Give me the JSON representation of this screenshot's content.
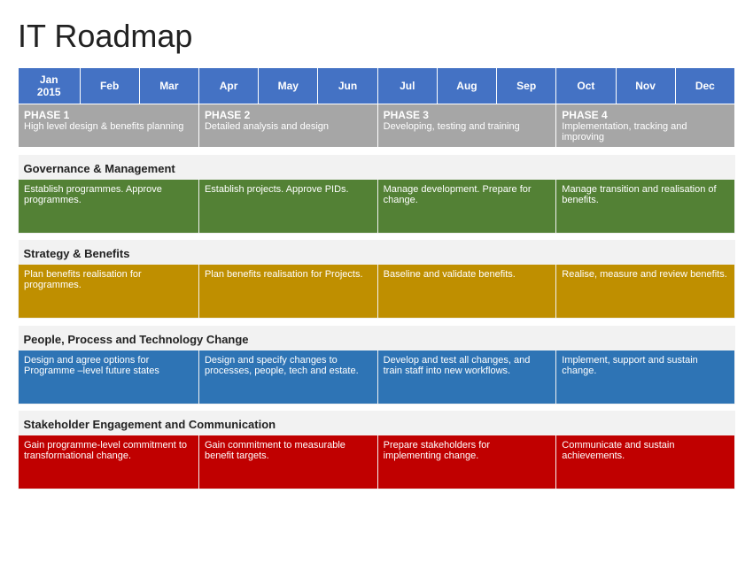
{
  "title": "IT Roadmap",
  "headers": [
    "Jan\n2015",
    "Feb",
    "Mar",
    "Apr",
    "May",
    "Jun",
    "Jul",
    "Aug",
    "Sep",
    "Oct",
    "Nov",
    "Dec"
  ],
  "phases": [
    {
      "title": "PHASE 1",
      "subtitle": "High level design & benefits planning",
      "span": 3,
      "color": "gray"
    },
    {
      "title": "PHASE 2",
      "subtitle": "Detailed analysis and design",
      "span": 3,
      "color": "gray"
    },
    {
      "title": "PHASE 3",
      "subtitle": "Developing, testing and training",
      "span": 3,
      "color": "gray"
    },
    {
      "title": "PHASE 4",
      "subtitle": "Implementation, tracking and improving",
      "span": 3,
      "color": "gray"
    }
  ],
  "sections": [
    {
      "name": "Governance & Management",
      "rows": [
        {
          "cells": [
            {
              "text": "Establish programmes. Approve programmes.",
              "color": "green",
              "span": 3
            },
            {
              "text": "Establish projects. Approve PIDs.",
              "color": "green",
              "span": 3
            },
            {
              "text": "Manage development. Prepare for change.",
              "color": "green",
              "span": 3
            },
            {
              "text": "Manage transition and realisation of benefits.",
              "color": "green",
              "span": 3
            }
          ]
        }
      ]
    },
    {
      "name": "Strategy & Benefits",
      "rows": [
        {
          "cells": [
            {
              "text": "Plan benefits realisation for programmes.",
              "color": "yellow",
              "span": 3
            },
            {
              "text": "Plan benefits realisation for Projects.",
              "color": "yellow",
              "span": 3
            },
            {
              "text": "Baseline and validate benefits.",
              "color": "yellow",
              "span": 3
            },
            {
              "text": "Realise, measure and review benefits.",
              "color": "yellow",
              "span": 3
            }
          ]
        }
      ]
    },
    {
      "name": "People, Process and Technology Change",
      "rows": [
        {
          "cells": [
            {
              "text": "Design and agree options for Programme –level future states",
              "color": "blue",
              "span": 3
            },
            {
              "text": "Design and specify changes to processes, people, tech and estate.",
              "color": "blue",
              "span": 3
            },
            {
              "text": "Develop and test all changes, and train staff into new workflows.",
              "color": "blue",
              "span": 3
            },
            {
              "text": "Implement, support and sustain change.",
              "color": "blue",
              "span": 3
            }
          ]
        }
      ]
    },
    {
      "name": "Stakeholder Engagement and Communication",
      "rows": [
        {
          "cells": [
            {
              "text": "Gain programme-level commitment to transformational change.",
              "color": "red",
              "span": 3
            },
            {
              "text": "Gain commitment to measurable benefit targets.",
              "color": "red",
              "span": 3
            },
            {
              "text": "Prepare stakeholders for implementing change.",
              "color": "red",
              "span": 3
            },
            {
              "text": "Communicate and sustain achievements.",
              "color": "red",
              "span": 3
            }
          ]
        }
      ]
    }
  ]
}
